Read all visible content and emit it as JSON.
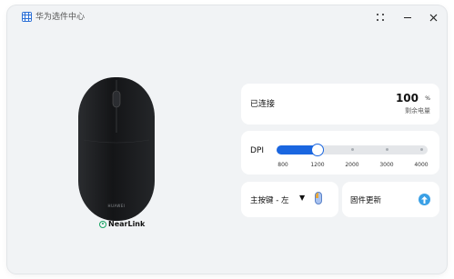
{
  "window": {
    "title": "华为选件中心"
  },
  "device": {
    "brand_label": "HUAWEI",
    "connectivity_logo": "NearLink"
  },
  "connection": {
    "status": "已连接",
    "battery_value": "100",
    "battery_unit": "%",
    "battery_label": "剩余电量"
  },
  "dpi": {
    "label": "DPI",
    "options": [
      "800",
      "1200",
      "2000",
      "3000",
      "4000"
    ],
    "selected": "1200",
    "accent_color": "#1a66e0"
  },
  "primary_key": {
    "label": "主按键 - 左",
    "caret_icon": "caret-down-icon",
    "icon": "mouse-left-button-icon"
  },
  "firmware": {
    "label": "固件更新",
    "icon": "upgrade-arrow-icon"
  }
}
